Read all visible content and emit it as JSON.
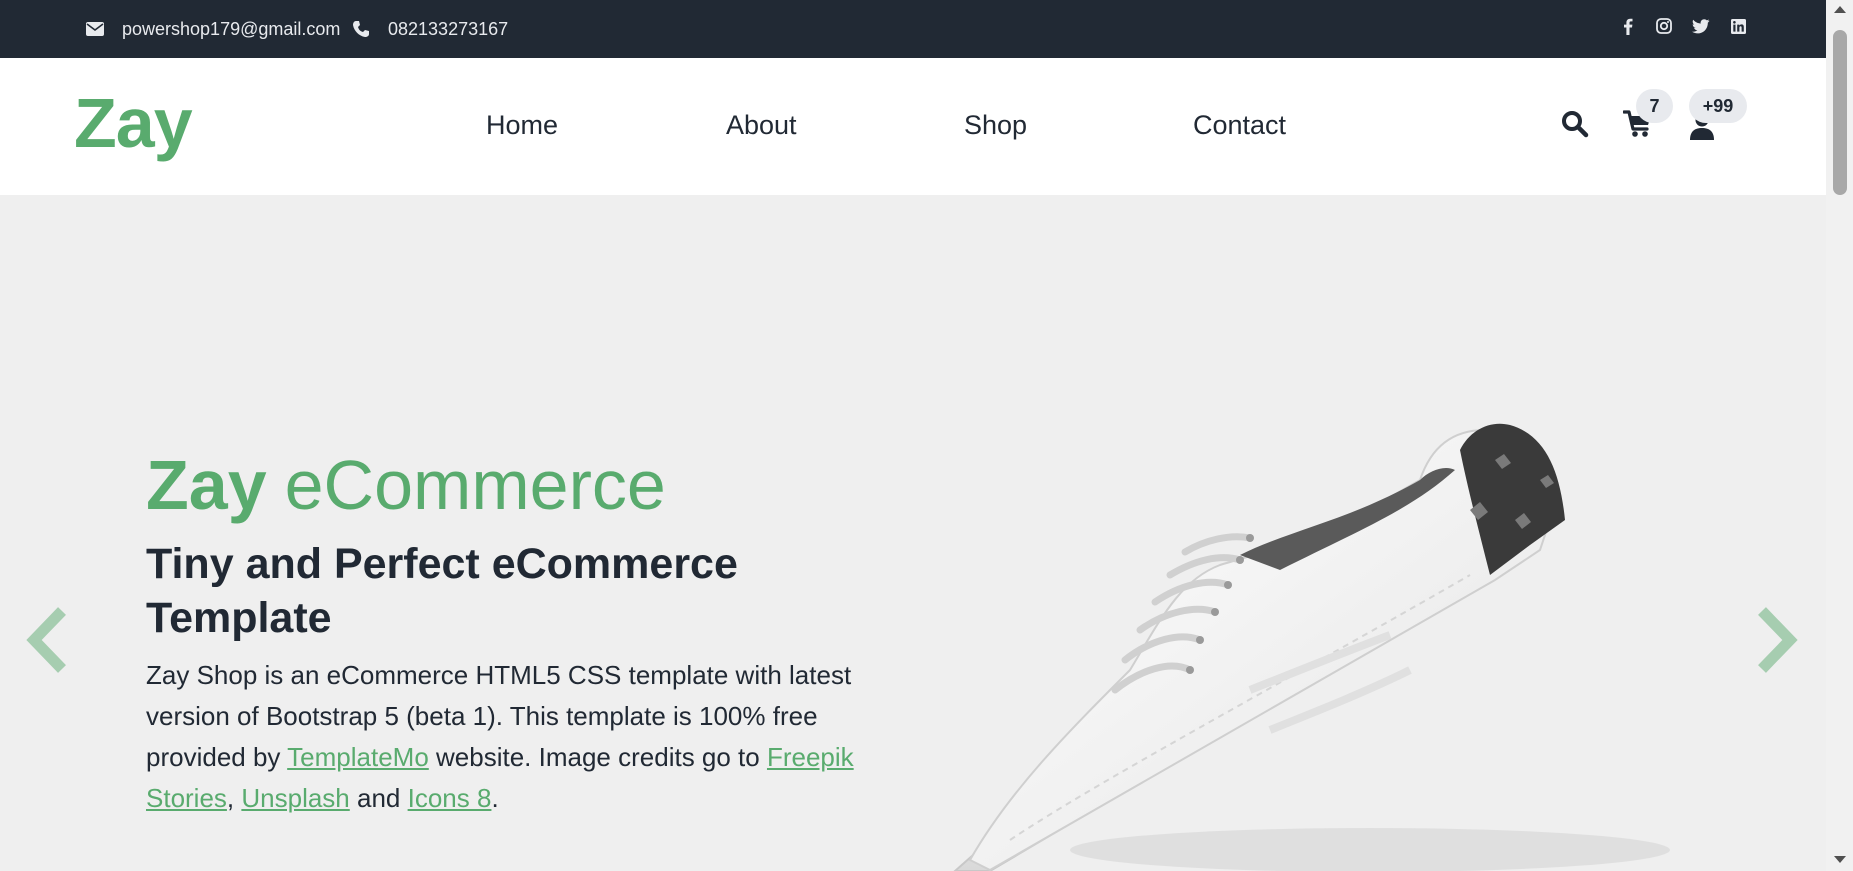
{
  "topbar": {
    "email": "powershop179@gmail.com",
    "phone": "082133273167",
    "social": [
      "facebook-icon",
      "instagram-icon",
      "twitter-icon",
      "linkedin-icon"
    ],
    "bg_color": "#212934"
  },
  "header": {
    "logo": "Zay",
    "nav": [
      "Home",
      "About",
      "Shop",
      "Contact"
    ],
    "cart_count": "7",
    "user_count": "+99"
  },
  "hero": {
    "title_bold": "Zay",
    "title_light": "eCommerce",
    "subtitle": "Tiny and Perfect eCommerce Template",
    "text_1": "Zay Shop is an eCommerce HTML5 CSS template with latest version of Bootstrap 5 (beta 1). This template is 100% free provided by ",
    "link_templatemo": "TemplateMo",
    "text_2": " website. Image credits go to ",
    "link_freepik": "Freepik Stories",
    "text_3": ", ",
    "link_unsplash": "Unsplash",
    "text_4": " and ",
    "link_icons8": "Icons 8",
    "text_5": "."
  },
  "colors": {
    "accent": "#59ab6e",
    "dark": "#212934",
    "hero_bg": "#efefef"
  }
}
